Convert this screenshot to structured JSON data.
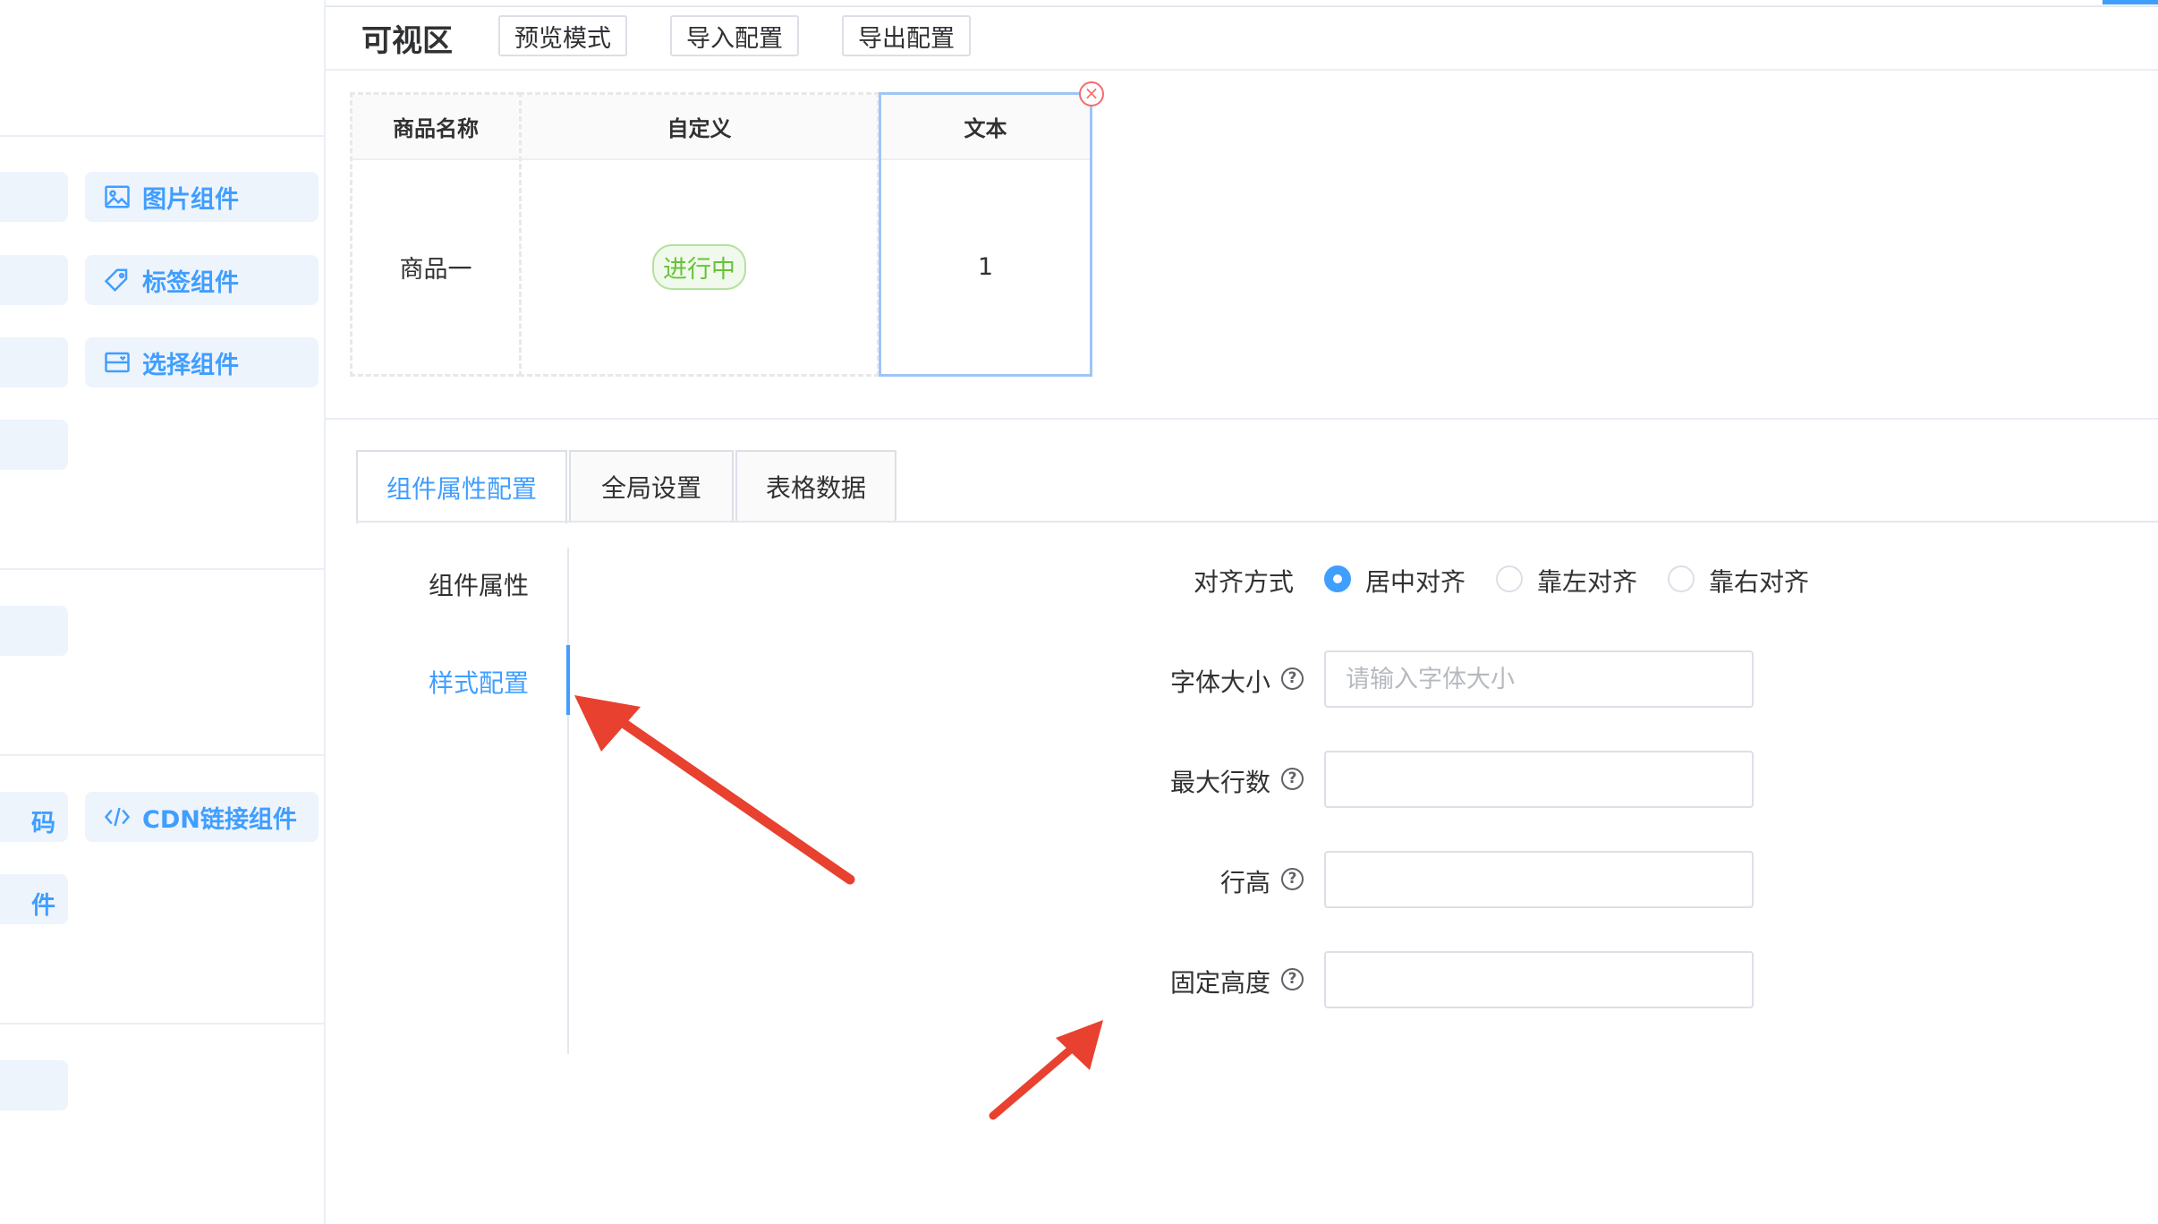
{
  "header": {
    "title": "可视区",
    "buttons": [
      "预览模式",
      "导入配置",
      "导出配置"
    ]
  },
  "sidebar": {
    "stubs": [
      "",
      "",
      "",
      "",
      "",
      "码",
      "件",
      ""
    ],
    "components": [
      {
        "label": "图片组件",
        "icon": "image-icon"
      },
      {
        "label": "标签组件",
        "icon": "tag-icon"
      },
      {
        "label": "选择组件",
        "icon": "select-icon"
      },
      {
        "label": "CDN链接组件",
        "icon": "code-icon"
      }
    ]
  },
  "table": {
    "columns": [
      {
        "header": "商品名称",
        "cell": "商品一"
      },
      {
        "header": "自定义",
        "cell": "进行中"
      },
      {
        "header": "文本",
        "cell": "1"
      }
    ],
    "close_symbol": "×"
  },
  "tabs": [
    {
      "label": "组件属性配置",
      "active": true
    },
    {
      "label": "全局设置",
      "active": false
    },
    {
      "label": "表格数据",
      "active": false
    }
  ],
  "subtabs": [
    {
      "label": "组件属性",
      "active": false
    },
    {
      "label": "样式配置",
      "active": true
    }
  ],
  "form": {
    "align": {
      "label": "对齐方式",
      "options": [
        "居中对齐",
        "靠左对齐",
        "靠右对齐"
      ],
      "selected": "居中对齐"
    },
    "font_size": {
      "label": "字体大小",
      "placeholder": "请输入字体大小",
      "value": ""
    },
    "max_lines": {
      "label": "最大行数",
      "value": ""
    },
    "line_height": {
      "label": "行高",
      "value": ""
    },
    "fixed_height": {
      "label": "固定高度",
      "value": ""
    },
    "help_symbol": "?"
  },
  "colors": {
    "accent": "#409eff",
    "tag_green": "#67c23a",
    "arrow_red": "#e8412f"
  }
}
